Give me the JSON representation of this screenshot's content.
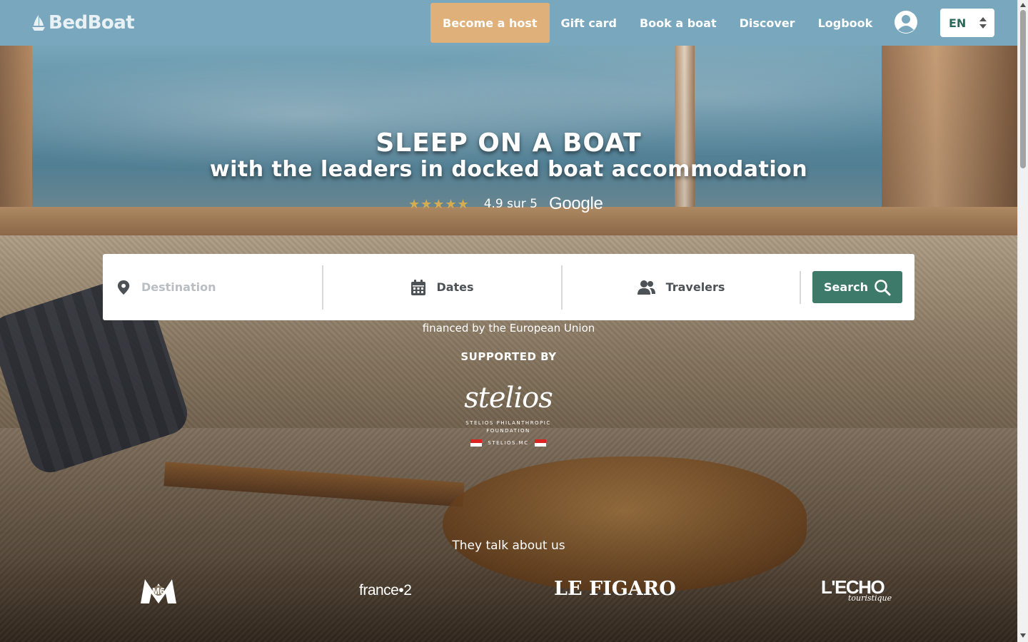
{
  "brand": {
    "name": "BedBoat"
  },
  "nav": {
    "host_label": "Become a host",
    "links": [
      "Gift card",
      "Book a boat",
      "Discover",
      "Logbook"
    ],
    "language": "EN"
  },
  "hero": {
    "title": "SLEEP ON A BOAT",
    "subtitle": "with the leaders in docked boat accommodation",
    "rating": {
      "stars": 5,
      "text": "4.9 sur 5",
      "source": "Google"
    }
  },
  "search": {
    "destination_placeholder": "Destination",
    "dates_label": "Dates",
    "travelers_label": "Travelers",
    "button_label": "Search"
  },
  "funding": {
    "eu_text": "financed by the European Union",
    "supported_by": "SUPPORTED BY",
    "sponsor": {
      "script": "stelios",
      "line1": "STELIOS PHILANTHROPIC",
      "line2": "FOUNDATION",
      "site": "STELIOS.MC"
    }
  },
  "press": {
    "heading": "They talk about us",
    "logos": [
      "M6",
      "france•2",
      "LE FIGARO",
      "L'ECHO",
      "touristique"
    ]
  },
  "colors": {
    "navbar": "#79a8be",
    "host_button": "#dfb07a",
    "search_button": "#3d7a6a",
    "stars": "#e2b24a"
  },
  "icons": [
    "boat-logo-icon",
    "user-avatar-icon",
    "select-arrows-icon",
    "map-pin-icon",
    "calendar-icon",
    "people-icon",
    "search-icon"
  ]
}
